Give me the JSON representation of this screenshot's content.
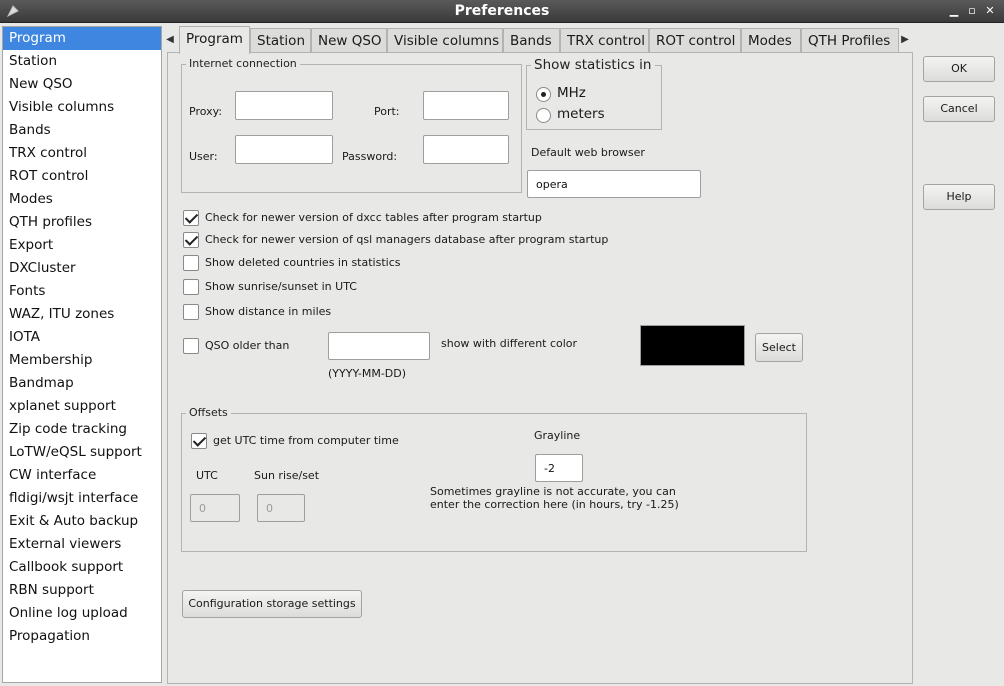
{
  "window": {
    "title": "Preferences"
  },
  "sidebar": {
    "items": [
      "Program",
      "Station",
      "New QSO",
      "Visible columns",
      "Bands",
      "TRX control",
      "ROT control",
      "Modes",
      "QTH profiles",
      "Export",
      "DXCluster",
      "Fonts",
      "WAZ, ITU zones",
      "IOTA",
      "Membership",
      "Bandmap",
      "xplanet support",
      "Zip code tracking",
      "LoTW/eQSL support",
      "CW interface",
      "fldigi/wsjt interface",
      "Exit & Auto backup",
      "External viewers",
      "Callbook support",
      "RBN support",
      "Online log upload",
      "Propagation"
    ]
  },
  "tabs": [
    "Program",
    "Station",
    "New QSO",
    "Visible columns",
    "Bands",
    "TRX control",
    "ROT control",
    "Modes",
    "QTH Profiles"
  ],
  "internet": {
    "group_title": "Internet connection",
    "proxy_label": "Proxy:",
    "port_label": "Port:",
    "user_label": "User:",
    "password_label": "Password:",
    "proxy_value": "",
    "port_value": "",
    "user_value": "",
    "password_value": ""
  },
  "statistics": {
    "group_title": "Show statistics in",
    "options": [
      "MHz",
      "meters"
    ],
    "selected": "MHz"
  },
  "browser": {
    "label": "Default web browser",
    "value": "opera"
  },
  "checks": [
    {
      "label": "Check for newer version of dxcc tables after program startup",
      "checked": true
    },
    {
      "label": "Check for newer version of qsl managers database  after program startup",
      "checked": true
    },
    {
      "label": "Show deleted countries in statistics",
      "checked": false
    },
    {
      "label": "Show sunrise/sunset in UTC",
      "checked": false
    },
    {
      "label": "Show distance in miles",
      "checked": false
    }
  ],
  "qso_older": {
    "label": "QSO older than",
    "checked": false,
    "value": "",
    "format_hint": "(YYYY-MM-DD)",
    "color_label": "show with different color",
    "color": "#000000",
    "select_label": "Select"
  },
  "offsets": {
    "group_title": "Offsets",
    "utc_check_label": "get UTC time from computer time",
    "utc_checked": true,
    "utc_label": "UTC",
    "utc_value": "0",
    "sunrise_label": "Sun rise/set",
    "sunrise_value": "0",
    "grayline_label": "Grayline",
    "grayline_value": "-2",
    "grayline_note_1": "Sometimes grayline is not accurate, you can",
    "grayline_note_2": "enter the correction here (in hours, try -1.25)"
  },
  "config_button": "Configuration storage settings",
  "dialog_buttons": {
    "ok": "OK",
    "cancel": "Cancel",
    "help": "Help"
  }
}
